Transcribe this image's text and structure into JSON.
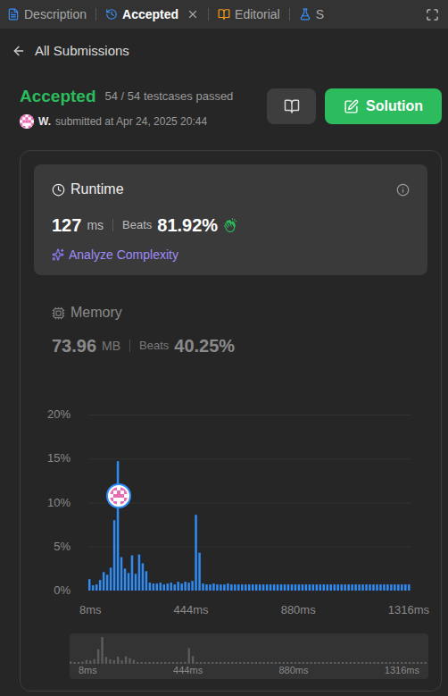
{
  "tabs": [
    {
      "label": "Description",
      "selected": false,
      "closable": false
    },
    {
      "label": "Accepted",
      "selected": true,
      "closable": true
    },
    {
      "label": "Editorial",
      "selected": false,
      "closable": false
    },
    {
      "label": "S",
      "selected": false,
      "closable": false
    }
  ],
  "back_link": "All Submissions",
  "submission": {
    "status": "Accepted",
    "testcases": "54 / 54 testcases passed",
    "user": "W.",
    "submitted": "submitted at Apr 24, 2025 20:44"
  },
  "solution_button": "Solution",
  "metrics": [
    {
      "label": "Runtime",
      "value": "127",
      "unit": "ms",
      "beats_label": "Beats",
      "beats": "81.92%",
      "selected": true,
      "action": "Analyze Complexity"
    },
    {
      "label": "Memory",
      "value": "73.96",
      "unit": "MB",
      "beats_label": "Beats",
      "beats": "40.25%",
      "selected": false
    }
  ],
  "chart": {
    "y_ticks": [
      "20%",
      "15%",
      "10%",
      "5%",
      "0%"
    ],
    "x_ticks": [
      "8ms",
      "444ms",
      "880ms",
      "1316ms"
    ],
    "y_max": 20,
    "values": [
      1.3,
      0.6,
      0.7,
      1.2,
      2.1,
      1.8,
      2.6,
      8.0,
      14.7,
      3.8,
      2.5,
      2.0,
      4.0,
      1.9,
      4.1,
      3.1,
      2.2,
      0.9,
      0.8,
      0.8,
      0.9,
      0.7,
      0.8,
      0.9,
      0.7,
      1.0,
      0.8,
      1.0,
      0.9,
      1.1,
      8.6,
      4.3,
      0.8,
      0.7,
      0.7,
      0.8,
      0.7,
      0.7,
      0.7,
      0.8,
      0.7,
      0.7,
      0.7,
      0.7,
      0.7,
      0.7,
      0.7,
      0.7,
      0.7,
      0.7,
      0.7,
      0.7,
      0.7,
      0.7,
      0.7,
      0.7,
      0.7,
      0.7,
      0.7,
      0.7,
      0.7,
      0.7,
      0.7,
      0.7,
      0.7,
      0.7,
      0.7,
      0.7,
      0.7,
      0.7,
      0.7,
      0.7,
      0.7,
      0.7,
      0.7,
      0.7,
      0.7,
      0.7,
      0.7,
      0.7,
      0.7,
      0.7,
      0.7,
      0.7,
      0.7,
      0.7,
      0.7,
      0.7,
      0.7,
      0.7,
      0.7
    ],
    "user_point": {
      "bar": 8,
      "value": 10.8
    }
  }
}
